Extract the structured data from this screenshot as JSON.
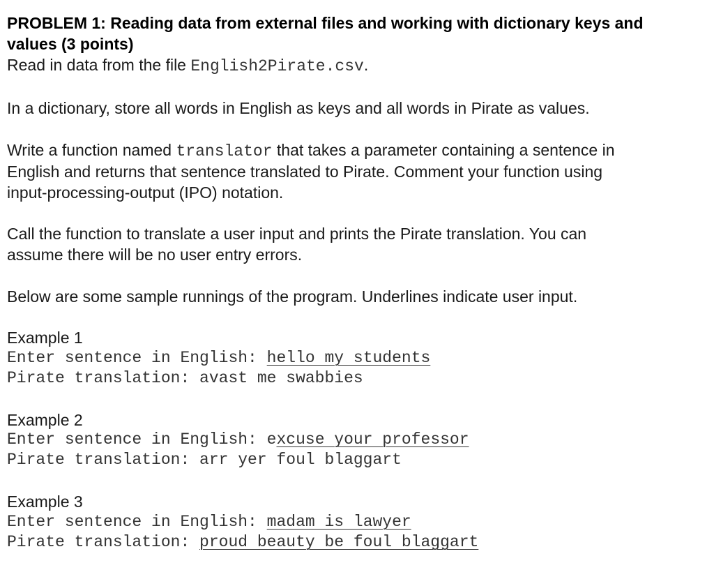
{
  "heading": {
    "line1": "PROBLEM 1: Reading data from external files and working with dictionary keys and",
    "line2": "values (3 points)"
  },
  "para1": {
    "prefix": "Read in data from the file ",
    "filename": "English2Pirate.csv",
    "suffix": "."
  },
  "para2": "In a dictionary, store all words in English as keys and all words in Pirate as values.",
  "para3": {
    "l1_prefix": "Write a function named ",
    "func_name": "translator",
    "l1_suffix": " that takes a parameter containing a sentence in",
    "l2": "English and returns that sentence translated to Pirate. Comment your function using",
    "l3": "input-processing-output (IPO) notation."
  },
  "para4": {
    "l1": "Call the function to translate a user input and prints the Pirate translation. You can",
    "l2": "assume there will be no user entry errors."
  },
  "para5": "Below are some sample runnings of the program. Underlines indicate user input.",
  "examples": [
    {
      "title": "Example 1",
      "prompt": "Enter sentence in English: ",
      "input": "hello my students",
      "output_label": "Pirate translation: ",
      "output": "avast me swabbies"
    },
    {
      "title": "Example 2",
      "prompt": "Enter sentence in English: ",
      "input_plain": "e",
      "input": "xcuse your professor",
      "output_label": "Pirate translation: ",
      "output": "arr yer foul blaggart"
    },
    {
      "title": "Example 3",
      "prompt": "Enter sentence in English: ",
      "input": "madam is lawyer",
      "output_label": "Pirate translation: ",
      "output": "proud beauty be foul blaggart"
    }
  ]
}
